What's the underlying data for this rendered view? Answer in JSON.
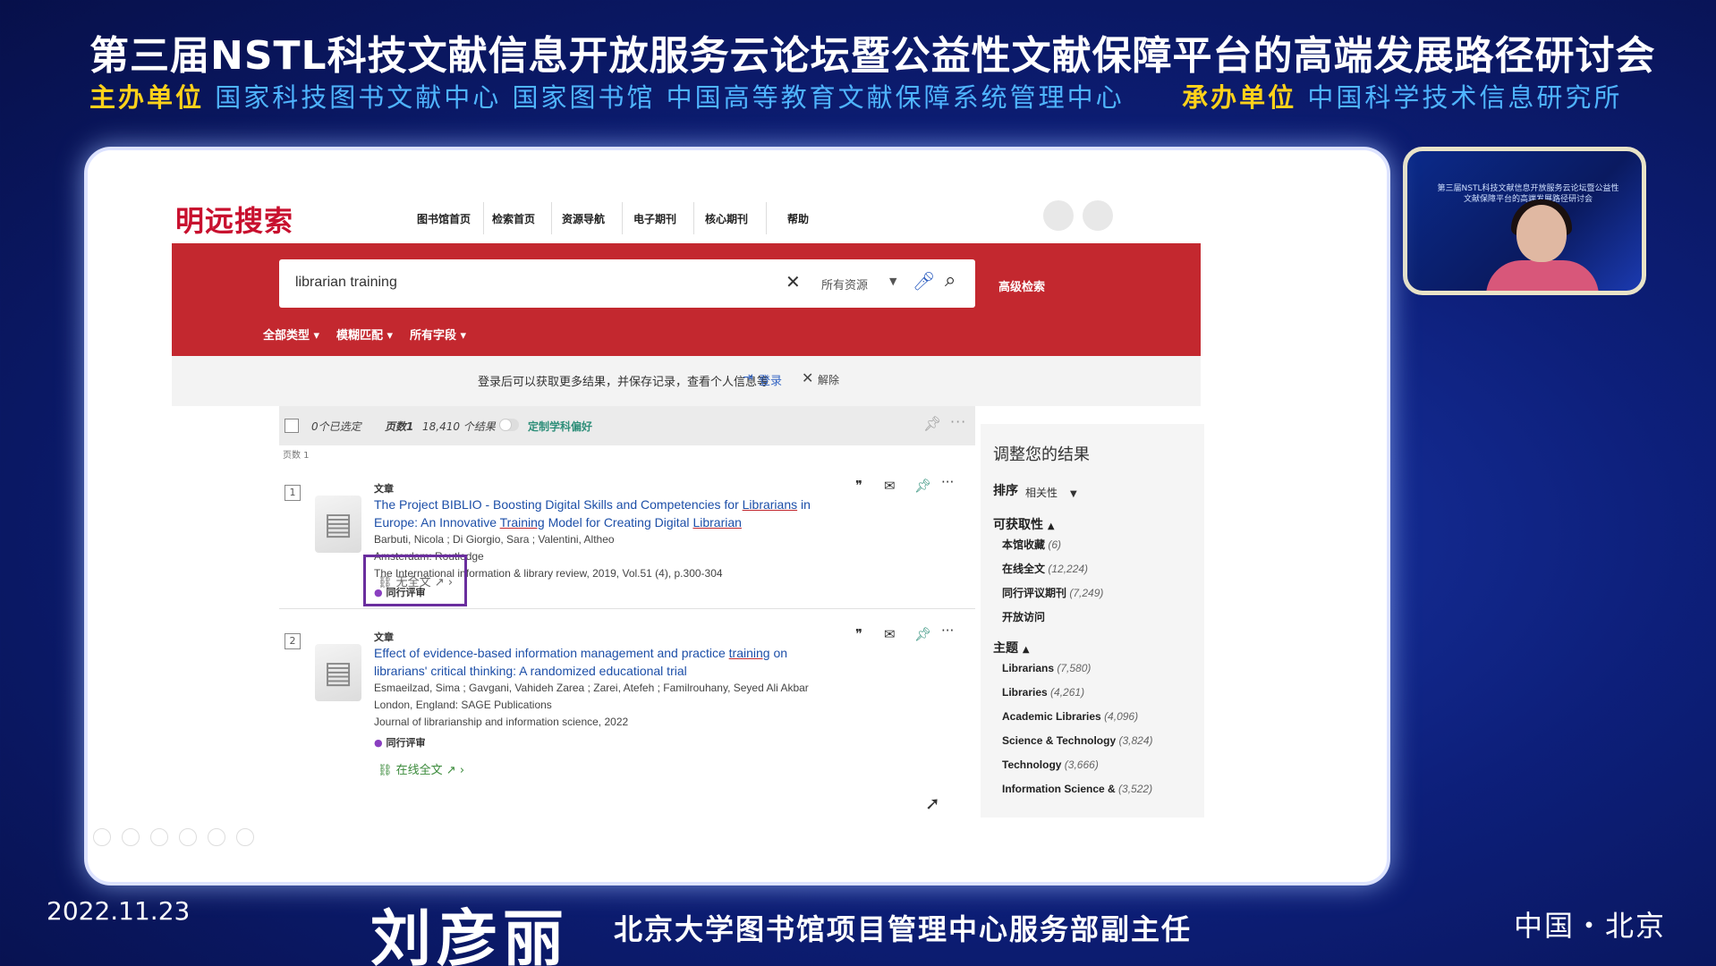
{
  "banner": {
    "title": "第三届NSTL科技文献信息开放服务云论坛暨公益性文献保障平台的高端发展路径研讨会",
    "host_label": "主办单位",
    "host_orgs": "国家科技图书文献中心 国家图书馆 中国高等教育文献保障系统管理中心",
    "organizer_label": "承办单位",
    "organizer_org": "中国科学技术信息研究所"
  },
  "footer": {
    "date": "2022.11.23",
    "speaker": "刘彦丽",
    "role": "北京大学图书馆项目管理中心服务部副主任",
    "location": "中国・北京"
  },
  "camera": {
    "caption": "第三届NSTL科技文献信息开放服务云论坛暨公益性文献保障平台的高端发展路径研讨会"
  },
  "site": {
    "logo": "明远搜索",
    "nav": [
      "图书馆首页",
      "检索首页",
      "资源导航",
      "电子期刊",
      "核心期刊",
      "帮助"
    ]
  },
  "search": {
    "query": "librarian training",
    "scope": "所有资源",
    "advanced": "高级检索",
    "filters": [
      "全部类型",
      "模糊匹配",
      "所有字段"
    ]
  },
  "login_bar": {
    "message": "登录后可以获取更多结果，并保存记录，查看个人信息等",
    "login": "登录",
    "dismiss": "解除"
  },
  "toolbar": {
    "selected": "0个已选定",
    "page": "页数1",
    "count": "18,410 个结果",
    "pref": "定制学科偏好"
  },
  "page_note": "页数 1",
  "results": [
    {
      "num": "1",
      "type": "文章",
      "title_parts": [
        "The Project BIBLIO - Boosting Digital Skills and Competencies for ",
        "Librarians",
        " in Europe: An Innovative ",
        "Training",
        " Model for Creating Digital ",
        "Librarian"
      ],
      "authors": "Barbuti, Nicola ; Di Giorgio, Sara ; Valentini, Altheo",
      "publisher": "Amsterdam: Routledge",
      "source": "The International information & library review, 2019, Vol.51 (4), p.300-304",
      "peer": "同行评审",
      "link": "无全文"
    },
    {
      "num": "2",
      "type": "文章",
      "title_parts": [
        "Effect of evidence-based information management and practice ",
        "training",
        " on librarians' critical thinking: A randomized educational trial"
      ],
      "authors": "Esmaeilzad, Sima ; Gavgani, Vahideh Zarea ; Zarei, Atefeh ; Familrouhany, Seyed Ali Akbar",
      "publisher": "London, England: SAGE Publications",
      "source": "Journal of librarianship and information science, 2022",
      "peer": "同行评审",
      "link": "在线全文"
    }
  ],
  "sidebar": {
    "heading": "调整您的结果",
    "sort_label": "排序",
    "sort_value": "相关性",
    "availability_label": "可获取性",
    "availability": [
      {
        "label": "本馆收藏",
        "count": "(6)"
      },
      {
        "label": "在线全文",
        "count": "(12,224)"
      },
      {
        "label": "同行评议期刊",
        "count": "(7,249)"
      },
      {
        "label": "开放访问",
        "count": ""
      }
    ],
    "topic_label": "主题",
    "topics": [
      {
        "label": "Librarians",
        "count": "(7,580)"
      },
      {
        "label": "Libraries",
        "count": "(4,261)"
      },
      {
        "label": "Academic Libraries",
        "count": "(4,096)"
      },
      {
        "label": "Science & Technology",
        "count": "(3,824)"
      },
      {
        "label": "Technology",
        "count": "(3,666)"
      },
      {
        "label": "Information Science &",
        "count": "(3,522)"
      }
    ]
  },
  "colors": {
    "brand_red": "#c3282f",
    "link_blue": "#1d4fa8",
    "highlight_purple": "#6a2e9e",
    "banner_yellow": "#ffd21a"
  }
}
